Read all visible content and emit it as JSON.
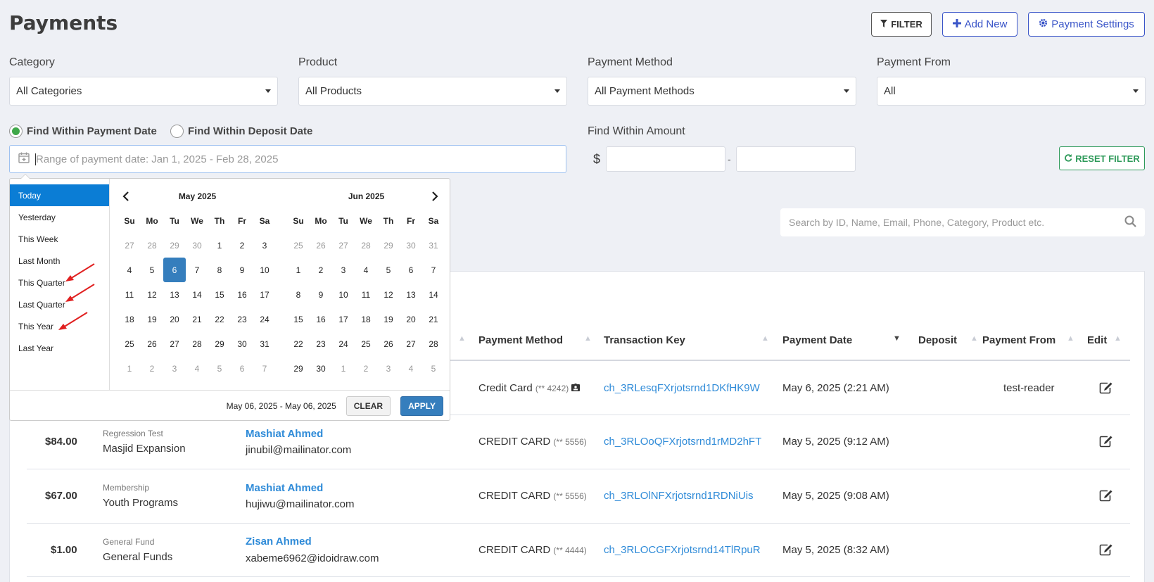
{
  "page": {
    "title": "Payments"
  },
  "toolbar": {
    "filter_label": "FILTER",
    "add_label": "Add New",
    "settings_label": "Payment Settings"
  },
  "filters": {
    "category": {
      "label": "Category",
      "value": "All Categories"
    },
    "product": {
      "label": "Product",
      "value": "All Products"
    },
    "method": {
      "label": "Payment Method",
      "value": "All Payment Methods"
    },
    "from": {
      "label": "Payment From",
      "value": "All"
    },
    "radio_payment": "Find Within Payment Date",
    "radio_deposit": "Find Within Deposit Date",
    "date_placeholder": "Range of payment date: Jan 1, 2025 - Feb 28, 2025",
    "amount_label": "Find Within Amount",
    "currency": "$",
    "amount_sep": "-",
    "reset_label": "RESET FILTER"
  },
  "search": {
    "placeholder": "Search by ID, Name, Email, Phone, Category, Product etc."
  },
  "picker": {
    "ranges": [
      "Today",
      "Yesterday",
      "This Week",
      "Last Month",
      "This Quarter",
      "Last Quarter",
      "This Year",
      "Last Year"
    ],
    "left_month": "May 2025",
    "right_month": "Jun 2025",
    "dow": [
      "Su",
      "Mo",
      "Tu",
      "We",
      "Th",
      "Fr",
      "Sa"
    ],
    "left_days": [
      "27",
      "28",
      "29",
      "30",
      "1",
      "2",
      "3",
      "4",
      "5",
      "6",
      "7",
      "8",
      "9",
      "10",
      "11",
      "12",
      "13",
      "14",
      "15",
      "16",
      "17",
      "18",
      "19",
      "20",
      "21",
      "22",
      "23",
      "24",
      "25",
      "26",
      "27",
      "28",
      "29",
      "30",
      "31",
      "1",
      "2",
      "3",
      "4",
      "5",
      "6",
      "7"
    ],
    "right_days": [
      "25",
      "26",
      "27",
      "28",
      "29",
      "30",
      "31",
      "1",
      "2",
      "3",
      "4",
      "5",
      "6",
      "7",
      "8",
      "9",
      "10",
      "11",
      "12",
      "13",
      "14",
      "15",
      "16",
      "17",
      "18",
      "19",
      "20",
      "21",
      "22",
      "23",
      "24",
      "25",
      "26",
      "27",
      "28",
      "29",
      "30",
      "1",
      "2",
      "3",
      "4",
      "5"
    ],
    "selected_range": "May 06, 2025 - May 06, 2025",
    "clear_label": "CLEAR",
    "apply_label": "APPLY"
  },
  "table": {
    "headers": {
      "method": "Payment Method",
      "key": "Transaction Key",
      "date": "Payment Date",
      "deposit": "Deposit",
      "from": "Payment From",
      "edit": "Edit"
    },
    "rows": [
      {
        "amount": "",
        "category": "",
        "product": "",
        "name": "",
        "email": "",
        "method": "Credit Card",
        "mask": "(** 4242)",
        "key": "ch_3RLesqFXrjotsrnd1DKfHK9W",
        "date": "May 6, 2025 (2:21 AM)",
        "from": "test-reader"
      },
      {
        "amount": "$84.00",
        "category": "Regression Test",
        "product": "Masjid Expansion",
        "name": "Mashiat Ahmed",
        "email": "jinubil@mailinator.com",
        "method": "CREDIT CARD",
        "mask": "(** 5556)",
        "key": "ch_3RLOoQFXrjotsrnd1rMD2hFT",
        "date": "May 5, 2025 (9:12 AM)",
        "from": ""
      },
      {
        "amount": "$67.00",
        "category": "Membership",
        "product": "Youth Programs",
        "name": "Mashiat Ahmed",
        "email": "hujiwu@mailinator.com",
        "method": "CREDIT CARD",
        "mask": "(** 5556)",
        "key": "ch_3RLOlNFXrjotsrnd1RDNiUis",
        "date": "May 5, 2025 (9:08 AM)",
        "from": ""
      },
      {
        "amount": "$1.00",
        "category": "General Fund",
        "product": "General Funds",
        "name": "Zisan Ahmed",
        "email": "xabeme6962@idoidraw.com",
        "method": "CREDIT CARD",
        "mask": "(** 4444)",
        "key": "ch_3RLOCGFXrjotsrnd14TlRpuR",
        "date": "May 5, 2025 (8:32 AM)",
        "from": ""
      }
    ]
  },
  "colors": {
    "primary": "#3a55c8",
    "success": "#2e9a5a",
    "active_range": "#0b7dd5",
    "selected_day": "#357ebd",
    "link": "#2f8bd8",
    "annotation": "#e02020"
  }
}
